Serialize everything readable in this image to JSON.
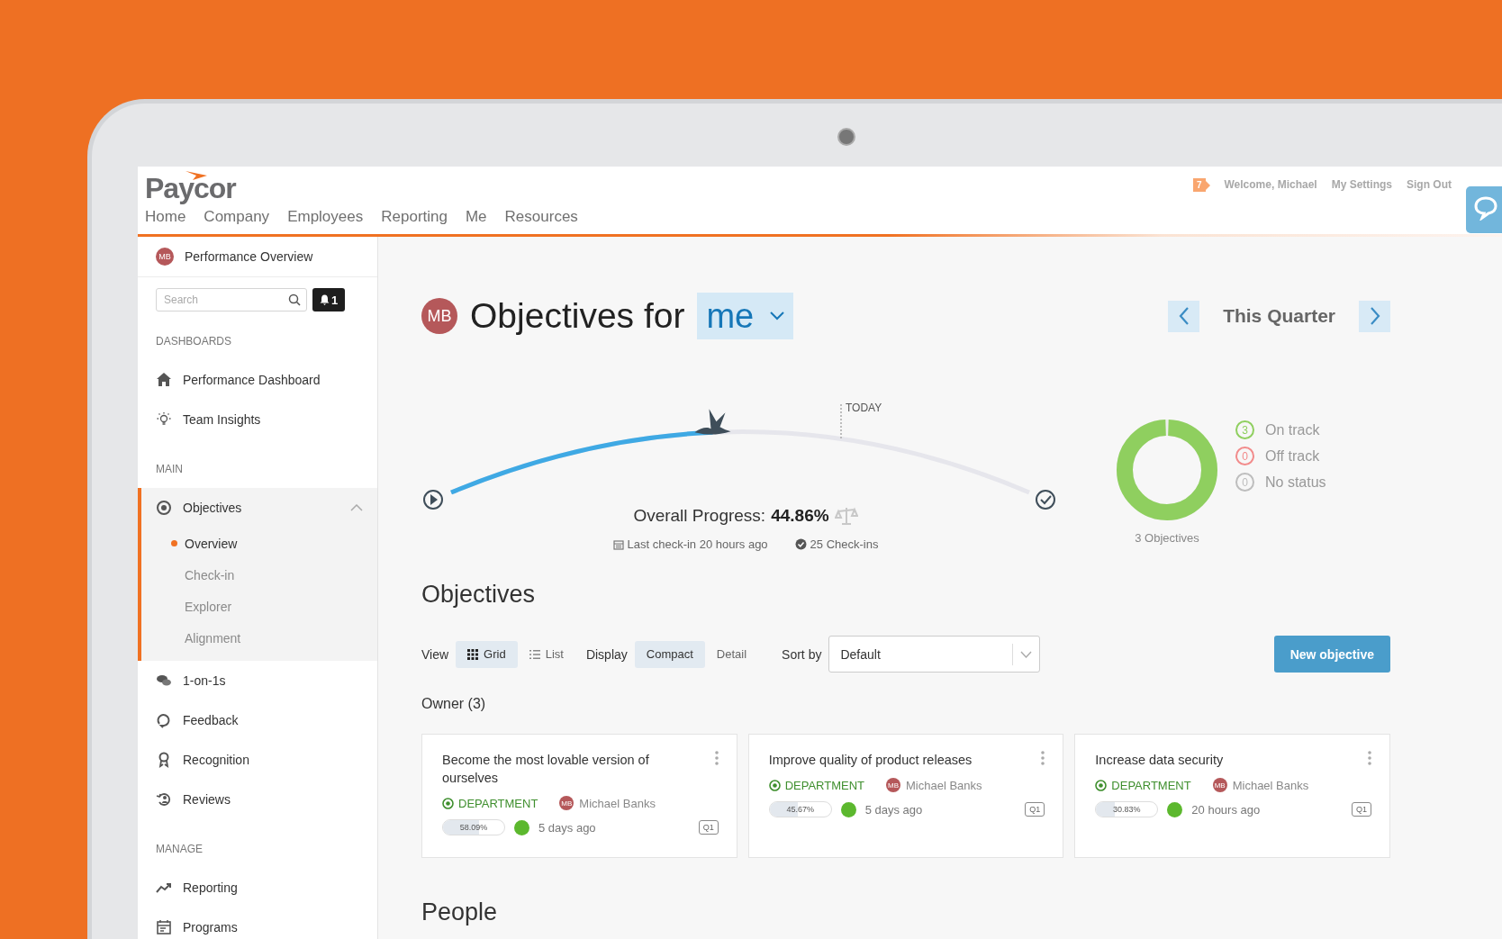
{
  "header": {
    "logo": "Paycor",
    "nav": [
      "Home",
      "Company",
      "Employees",
      "Reporting",
      "Me",
      "Resources"
    ],
    "notification_count": "7",
    "links": [
      "Welcome, Michael",
      "My Settings",
      "Sign Out"
    ]
  },
  "sidebar": {
    "profile": {
      "initials": "MB",
      "label": "Performance Overview"
    },
    "search": {
      "placeholder": "Search"
    },
    "alerts": {
      "count": "1"
    },
    "sections": [
      {
        "heading": "DASHBOARDS",
        "items": [
          {
            "label": "Performance Dashboard",
            "selected": false
          },
          {
            "label": "Team Insights",
            "selected": false
          }
        ]
      },
      {
        "heading": "MAIN",
        "items": [
          {
            "label": "Objectives",
            "selected": true,
            "expanded": true,
            "children": [
              {
                "label": "Overview",
                "selected": true
              },
              {
                "label": "Check-in",
                "selected": false
              },
              {
                "label": "Explorer",
                "selected": false
              },
              {
                "label": "Alignment",
                "selected": false
              }
            ]
          },
          {
            "label": "1-on-1s",
            "selected": false
          },
          {
            "label": "Feedback",
            "selected": false
          },
          {
            "label": "Recognition",
            "selected": false
          },
          {
            "label": "Reviews",
            "selected": false
          }
        ]
      },
      {
        "heading": "MANAGE",
        "items": [
          {
            "label": "Reporting",
            "selected": false
          },
          {
            "label": "Programs",
            "selected": false
          }
        ]
      }
    ]
  },
  "page": {
    "owner_initials": "MB",
    "title": "Objectives for",
    "owner_select": "me",
    "period": "This Quarter"
  },
  "progress": {
    "label": "Overall Progress:",
    "value": "44.86%",
    "level": 0.4486,
    "today_label": "TODAY",
    "last_checkin": "Last check-in 20 hours ago",
    "checkins": "25 Check-ins"
  },
  "status_summary": {
    "items": [
      {
        "count": "3",
        "label": "On track",
        "color": "#8fcf5f"
      },
      {
        "count": "0",
        "label": "Off track",
        "color": "#f28b8b"
      },
      {
        "count": "0",
        "label": "No status",
        "color": "#bdbdbd"
      }
    ],
    "total": "3 Objectives"
  },
  "objectives": {
    "heading": "Objectives",
    "view": {
      "label": "View",
      "options": [
        {
          "label": "Grid",
          "selected": true
        },
        {
          "label": "List",
          "selected": false
        }
      ]
    },
    "display": {
      "label": "Display",
      "options": [
        {
          "label": "Compact",
          "selected": true
        },
        {
          "label": "Detail",
          "selected": false
        }
      ]
    },
    "sort": {
      "label": "Sort by",
      "value": "Default"
    },
    "new_button": "New objective",
    "group": "Owner (3)",
    "cards": [
      {
        "title": "Become the most lovable version of ourselves",
        "tag": "DEPARTMENT",
        "owner_initials": "MB",
        "owner": "Michael Banks",
        "progress": "58.09%",
        "level": 0.5809,
        "color": "#5cb82e",
        "updated": "5 days ago",
        "period": "Q1"
      },
      {
        "title": "Improve quality of product releases",
        "tag": "DEPARTMENT",
        "owner_initials": "MB",
        "owner": "Michael Banks",
        "progress": "45.67%",
        "level": 0.4567,
        "color": "#5cb82e",
        "updated": "5 days ago",
        "period": "Q1"
      },
      {
        "title": "Increase data security",
        "tag": "DEPARTMENT",
        "owner_initials": "MB",
        "owner": "Michael Banks",
        "progress": "30.83%",
        "level": 0.3083,
        "color": "#5cb82e",
        "updated": "20 hours ago",
        "period": "Q1"
      }
    ]
  },
  "people": {
    "heading": "People"
  }
}
